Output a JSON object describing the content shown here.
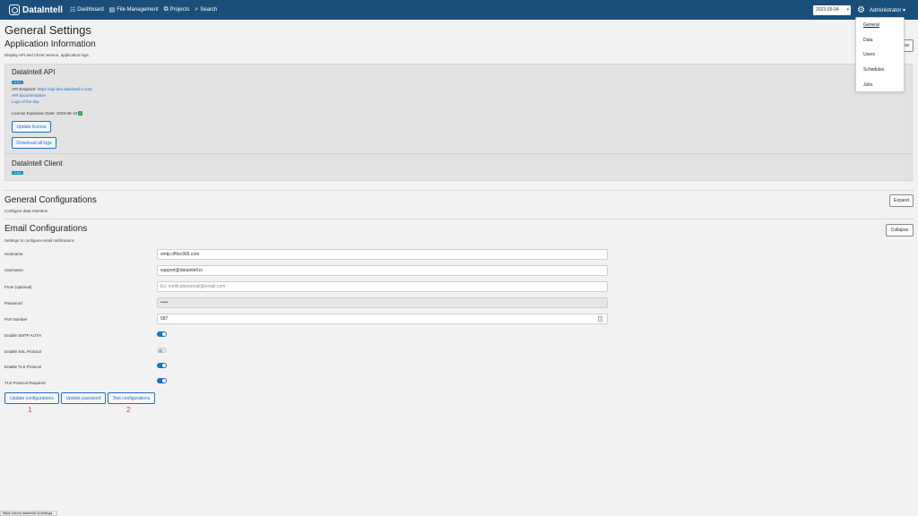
{
  "navbar": {
    "brand": "DataIntell",
    "links": [
      {
        "label": "Dashboard",
        "icon": "dashboard-icon"
      },
      {
        "label": "File Management",
        "icon": "folder-icon"
      },
      {
        "label": "Projects",
        "icon": "projects-icon"
      },
      {
        "label": "Search",
        "icon": "search-icon"
      }
    ],
    "date": "2023-05-04",
    "user": "Administrator ▾"
  },
  "dropdown": {
    "items": [
      "General",
      "Data",
      "Users",
      "Schedules",
      "Jobs"
    ],
    "active": "General"
  },
  "page": {
    "title": "General Settings"
  },
  "app_info": {
    "title": "Application Information",
    "subtitle": "Display API and Client version, application logs.",
    "collapse_label": "Collapse",
    "api": {
      "title": "DataIntell API",
      "version": "v1.8.1",
      "endpoint_label": "API Endpoint: ",
      "endpoint_url": "https://api-dev.dataintell.io:443",
      "docs_link": "API documentation",
      "logs_link": "Logs of the day",
      "license_label": "License Expiration Date: 2028-06-18",
      "update_license": "Update license",
      "download_logs": "Download all logs"
    },
    "client": {
      "title": "DataIntell Client",
      "version": "v1.8.1"
    }
  },
  "general_config": {
    "title": "General Configurations",
    "subtitle": "Configure data retention",
    "expand_label": "Expand"
  },
  "email_config": {
    "title": "Email Configurations",
    "subtitle": "Settings to configure email notifications",
    "collapse_label": "Collapse",
    "fields": {
      "hostname_label": "Hostname",
      "hostname_value": "smtp.office365.com",
      "username_label": "Username",
      "username_value": "support@dataintell.io",
      "from_label": "From (optional)",
      "from_placeholder": "Ex: notificationemail@email.com",
      "password_label": "Password",
      "password_value": "•••••",
      "port_label": "Port Number",
      "port_value": "587",
      "smtp_auth_label": "Enable SMTP AUTH",
      "ssl_label": "Enable SSL Protocol",
      "tls_label": "Enable TLS Protocol",
      "tls_required_label": "TLS Protocol Required"
    },
    "toggles": {
      "smtp_auth": true,
      "ssl": false,
      "tls": true,
      "tls_required": true
    },
    "buttons": {
      "update_config": "Update configurations",
      "update_password": "Update password",
      "test_config": "Test configurations"
    },
    "annotations": {
      "one": "1",
      "two": "2"
    }
  },
  "status_bar": {
    "url": "https://demo.dataintell.io/settings"
  }
}
